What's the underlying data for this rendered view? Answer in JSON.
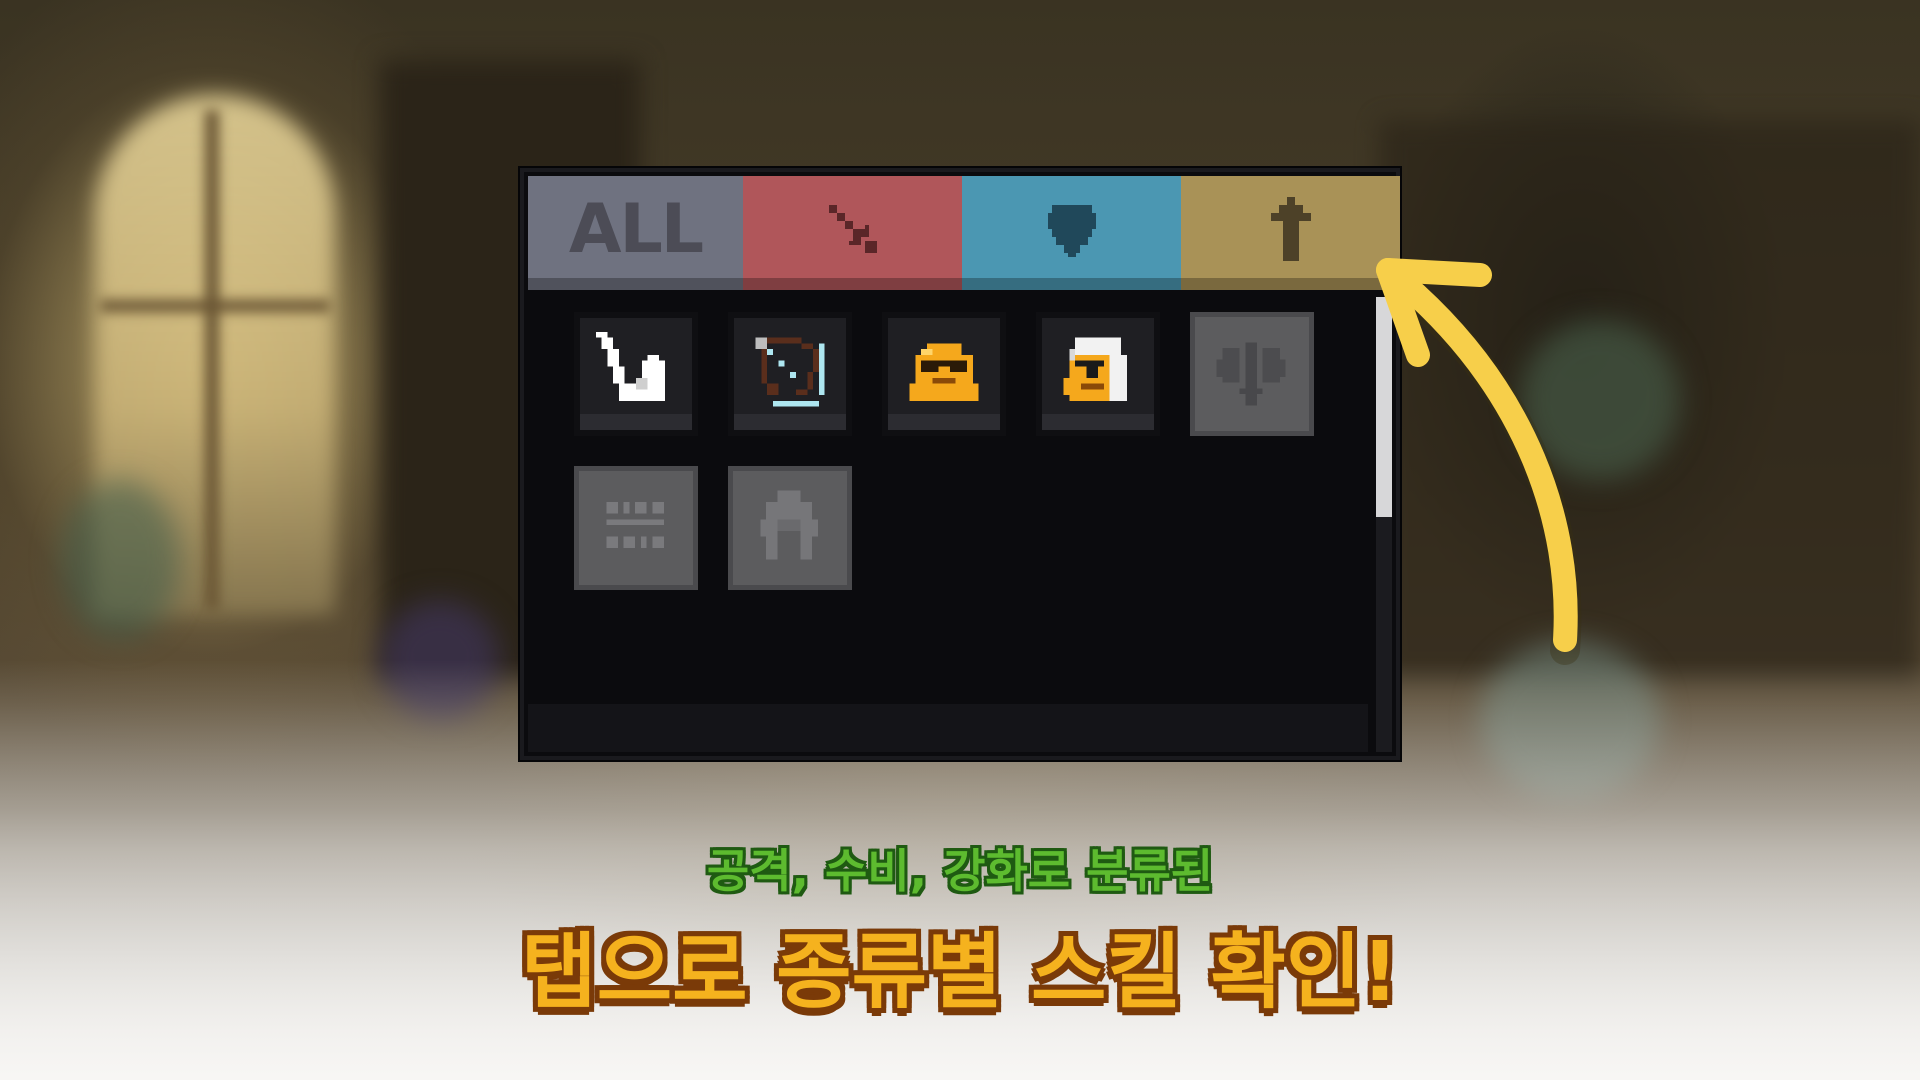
{
  "tabs": [
    {
      "label": "ALL",
      "icon": "",
      "color": "#6f7280"
    },
    {
      "label": "",
      "icon": "sword-icon",
      "color": "#b0565a"
    },
    {
      "label": "",
      "icon": "shield-icon",
      "color": "#4b97b2"
    },
    {
      "label": "",
      "icon": "up-arrow-icon",
      "color": "#a99257"
    }
  ],
  "skills": [
    {
      "icon": "flexed-arm-icon",
      "locked": false
    },
    {
      "icon": "bow-icon",
      "locked": false
    },
    {
      "icon": "sunglasses-slime-icon",
      "locked": false
    },
    {
      "icon": "hooded-warrior-icon",
      "locked": false
    },
    {
      "icon": "winged-sword-icon",
      "locked": true
    },
    {
      "icon": "teeth-icon",
      "locked": true
    },
    {
      "icon": "body-silhouette-icon",
      "locked": true
    }
  ],
  "caption": {
    "sub": "공격, 수비, 강화로 분류된",
    "main": "탭으로 종류별 스킬 확인!"
  },
  "colors": {
    "arrow": "#f7cf4a",
    "caption_sub": "#5dbb2f",
    "caption_main": "#f5b21e"
  }
}
